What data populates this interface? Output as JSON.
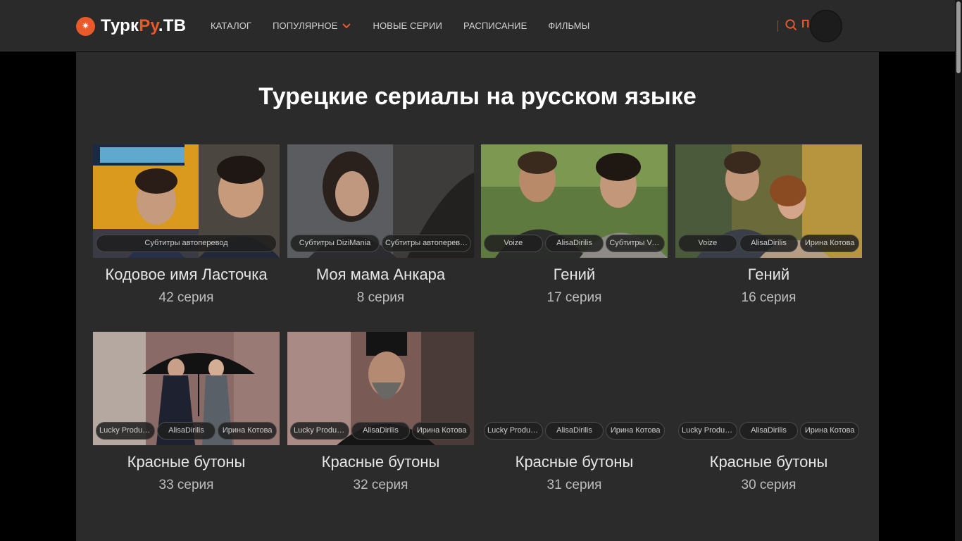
{
  "header": {
    "logo": {
      "part1": "Турк",
      "part2": "Ру",
      "part3": ".ТВ",
      "icon": "star-badge-icon"
    },
    "nav": [
      {
        "label": "КАТАЛОГ"
      },
      {
        "label": "ПОПУЛЯРНОЕ",
        "has_dropdown": true
      },
      {
        "label": "НОВЫЕ СЕРИИ"
      },
      {
        "label": "РАСПИСАНИЕ"
      },
      {
        "label": "ФИЛЬМЫ"
      }
    ],
    "search_label": "Поиск"
  },
  "main": {
    "title": "Турецкие сериалы на русском языке",
    "cards": [
      {
        "title": "Кодовое имя Ласточка",
        "episode": "42 серия",
        "tags": [
          "Субтитры автоперевод"
        ]
      },
      {
        "title": "Моя мама Анкара",
        "episode": "8 серия",
        "tags": [
          "Субтитры DiziMania",
          "Субтитры автоперевод"
        ]
      },
      {
        "title": "Гений",
        "episode": "17 серия",
        "tags": [
          "Voize",
          "AlisaDirilis",
          "Субтитры Voi…"
        ]
      },
      {
        "title": "Гений",
        "episode": "16 серия",
        "tags": [
          "Voize",
          "AlisaDirilis",
          "Ирина Котова"
        ]
      },
      {
        "title": "Красные бутоны",
        "episode": "33 серия",
        "tags": [
          "Lucky Produc…",
          "AlisaDirilis",
          "Ирина Котова"
        ]
      },
      {
        "title": "Красные бутоны",
        "episode": "32 серия",
        "tags": [
          "Lucky Produc…",
          "AlisaDirilis",
          "Ирина Котова"
        ]
      },
      {
        "title": "Красные бутоны",
        "episode": "31 серия",
        "tags": [
          "Lucky Produc…",
          "AlisaDirilis",
          "Ирина Котова"
        ]
      },
      {
        "title": "Красные бутоны",
        "episode": "30 серия",
        "tags": [
          "Lucky Produc…",
          "AlisaDirilis",
          "Ирина Котова"
        ]
      }
    ]
  },
  "colors": {
    "accent": "#e85a2a",
    "background": "#2b2b2b",
    "header": "#2a2a2a"
  }
}
